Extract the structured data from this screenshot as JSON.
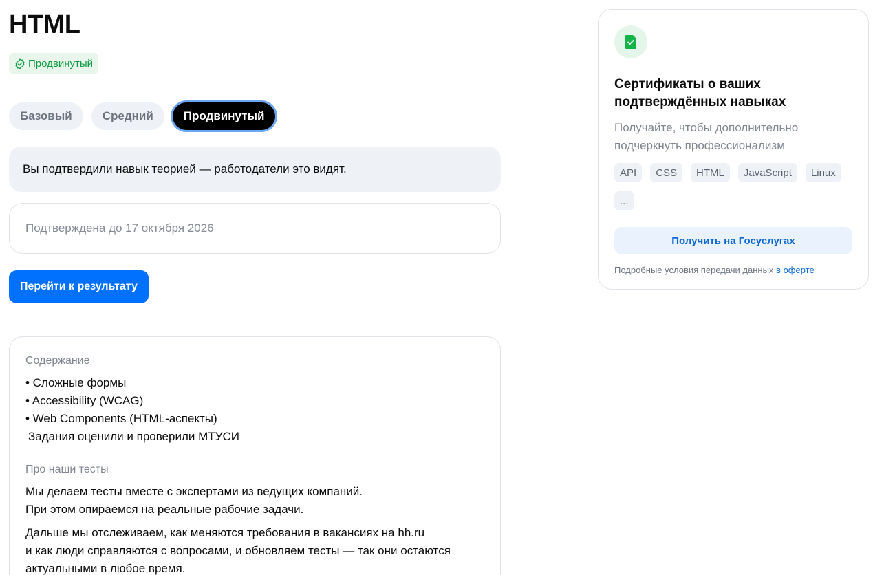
{
  "header": {
    "title": "HTML",
    "level_badge": "Продвинутый"
  },
  "level_tabs": [
    {
      "label": "Базовый",
      "active": false
    },
    {
      "label": "Средний",
      "active": false
    },
    {
      "label": "Продвинутый",
      "active": true
    }
  ],
  "info_message": "Вы подтвердили навык теорией — работодатели это видят.",
  "validity": "Подтверждена до 17 октября 2026",
  "result_button": "Перейти к результату",
  "content": {
    "section_label": "Содержание",
    "items": [
      "• Сложные формы",
      "• Accessibility (WCAG)",
      "• Web Components (HTML-аспекты)"
    ],
    "checked_by": "Задания оценили и проверили МТУСИ",
    "about_label": "Про наши тесты",
    "paragraph_1_line_1": "Мы делаем тесты вместе с экспертами из ведущих компаний.",
    "paragraph_1_line_2": "При этом опираемся на реальные рабочие задачи.",
    "paragraph_2_line_1": "Дальше мы отслеживаем, как меняются требования в вакансиях на hh.ru",
    "paragraph_2_line_2": "и как люди справляются с вопросами, и обновляем тесты — так они остаются",
    "paragraph_2_line_3": "актуальными в любое время."
  },
  "certificate": {
    "icon": "certificate-check-icon",
    "title_line_1": "Сертификаты о ваших",
    "title_line_2": "подтверждённых навыках",
    "desc_line_1": "Получайте, чтобы дополнительно",
    "desc_line_2": "подчеркнуть профессионализм",
    "skills": [
      "API",
      "CSS",
      "HTML",
      "JavaScript",
      "Linux",
      "..."
    ],
    "gosuslugi_button": "Получить на Госуслугах",
    "terms_text": "Подробные условия передачи данных",
    "terms_link": "в оферте"
  },
  "colors": {
    "accent_blue": "#0070ff",
    "success_green": "#0d9b43",
    "active_tab": "#000000"
  }
}
